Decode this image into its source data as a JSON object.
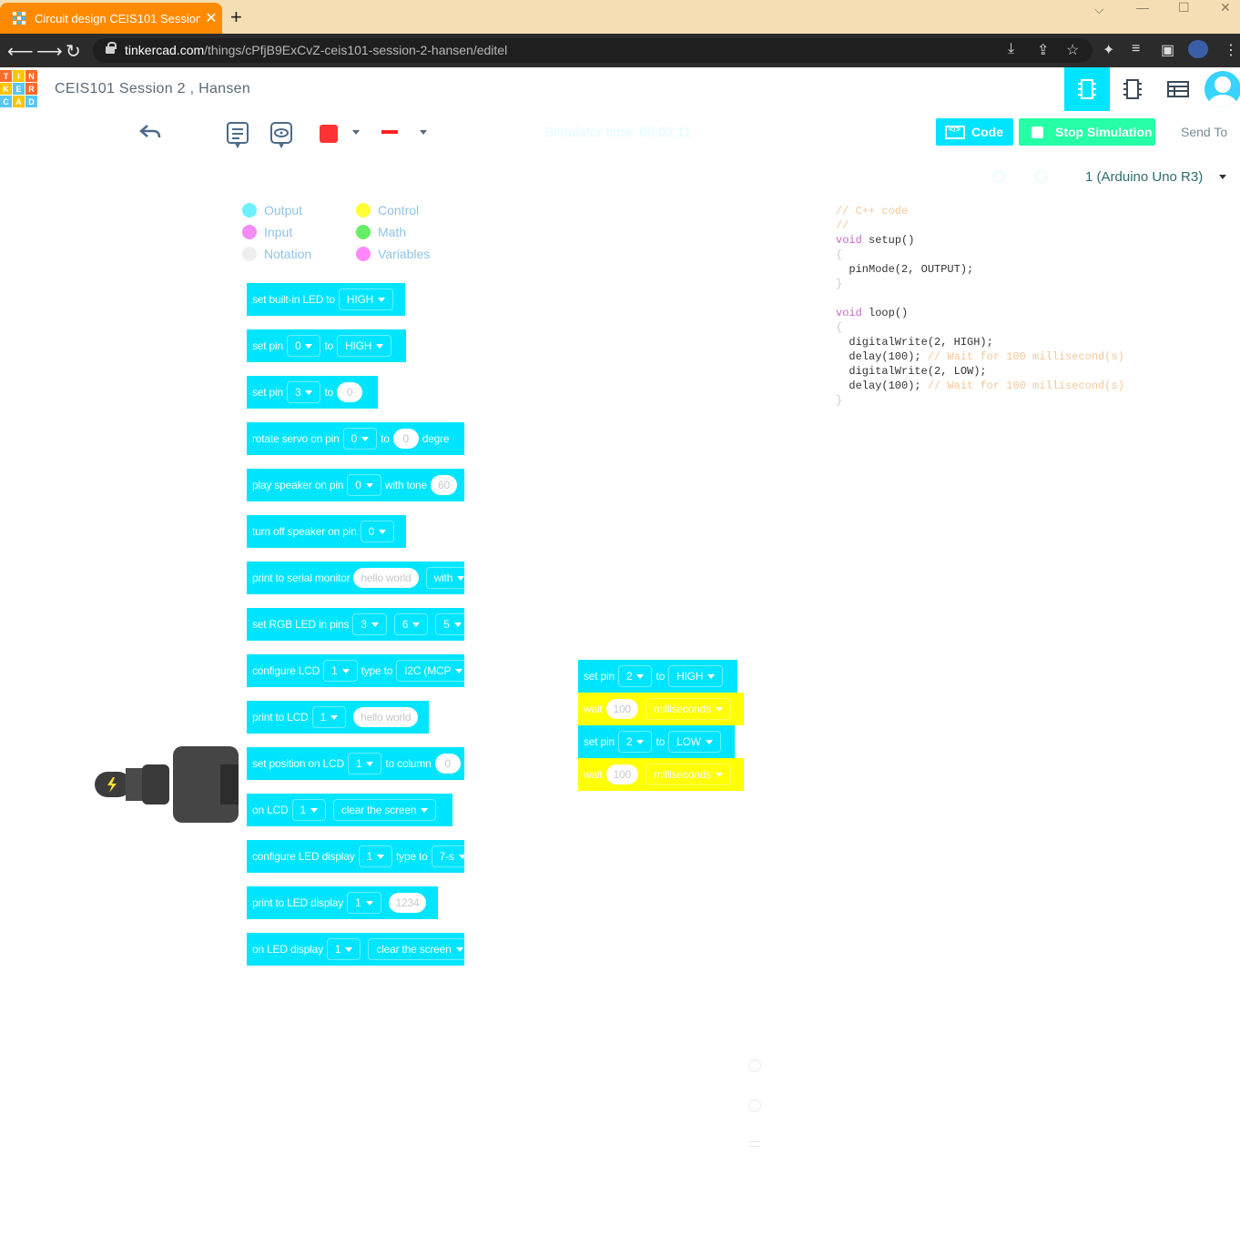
{
  "browser": {
    "tab_title": "Circuit design CEIS101 Session 2",
    "tab_close": "✕",
    "new_tab": "+",
    "url_host": "tinkercad.com",
    "url_path": "/things/cPfjB9ExCvZ-ceis101-session-2-hansen/editel",
    "window_controls": [
      "⌵",
      "—",
      "☐",
      "✕"
    ]
  },
  "app": {
    "logo_letters": [
      "T",
      "I",
      "N",
      "K",
      "E",
      "R",
      "C",
      "A",
      "D"
    ],
    "design_title": "CEIS101 Session 2 , Hansen"
  },
  "toolbar": {
    "simulator_time": "Simulator time: 00:02:11",
    "code_label": "Code",
    "stop_label": "Stop Simulation",
    "send_to_label": "Send To",
    "device_select": "1 (Arduino Uno R3)",
    "fill_color": "#ff3333",
    "line_color": "#ff2222"
  },
  "legend": {
    "items": [
      {
        "label": "Output",
        "color": "#6ff0ff"
      },
      {
        "label": "Input",
        "color": "#f28cf2"
      },
      {
        "label": "Notation",
        "color": "#eeeeee"
      },
      {
        "label": "Control",
        "color": "#ffff33"
      },
      {
        "label": "Math",
        "color": "#66ee66"
      },
      {
        "label": "Variables",
        "color": "#ff88ff"
      }
    ]
  },
  "palette": {
    "b1": {
      "text": "set built-in LED to",
      "dd": "HIGH"
    },
    "b2": {
      "text": "set pin",
      "dd1": "0",
      "to": "to",
      "dd2": "HIGH"
    },
    "b3": {
      "text": "set pin",
      "dd1": "3",
      "to": "to",
      "val": "0"
    },
    "b4": {
      "text": "rotate servo on pin",
      "dd1": "0",
      "to": "to",
      "val": "0",
      "tail": "degre"
    },
    "b5": {
      "text": "play speaker on pin",
      "dd1": "0",
      "mid": "with tone",
      "val": "60"
    },
    "b6": {
      "text": "turn off speaker on pin",
      "dd1": "0"
    },
    "b7": {
      "text": "print to serial monitor",
      "val": "hello world",
      "tail": "with"
    },
    "b8": {
      "text": "set RGB LED in pins",
      "dd1": "3",
      "dd2": "6",
      "dd3": "5"
    },
    "b9": {
      "text": "configure LCD",
      "dd1": "1",
      "mid": "type to",
      "dd2": "I2C (MCP"
    },
    "b10": {
      "text": "print to LCD",
      "dd1": "1",
      "val": "hello world"
    },
    "b11": {
      "text": "set position on LCD",
      "dd1": "1",
      "mid": "to column",
      "val": "0"
    },
    "b12": {
      "text": "on LCD",
      "dd1": "1",
      "dd2": "clear the screen"
    },
    "b13": {
      "text": "configure LED display",
      "dd1": "1",
      "mid": "type to",
      "dd2": "7-s"
    },
    "b14": {
      "text": "print to LED display",
      "dd1": "1",
      "val": "1234"
    },
    "b15": {
      "text": "on LED display",
      "dd1": "1",
      "dd2": "clear the screen"
    }
  },
  "program": {
    "s1": {
      "text": "set pin",
      "dd1": "2",
      "to": "to",
      "dd2": "HIGH"
    },
    "s2": {
      "text": "wait",
      "val": "100",
      "dd": "milliseconds"
    },
    "s3": {
      "text": "set pin",
      "dd1": "2",
      "to": "to",
      "dd2": "LOW"
    },
    "s4": {
      "text": "wait",
      "val": "100",
      "dd": "milliseconds"
    }
  },
  "code": {
    "l1": "// C++ code",
    "l2": "//",
    "l3a": "void",
    "l3b": " setup()",
    "l4": "{",
    "l5": "  pinMode(2, OUTPUT);",
    "l6": "}",
    "l7a": "void",
    "l7b": " loop()",
    "l8": "{",
    "l9": "  digitalWrite(2, HIGH);",
    "l10a": "  delay(100); ",
    "l10b": "// Wait for 100 millisecond(s)",
    "l11": "  digitalWrite(2, LOW);",
    "l12a": "  delay(100); ",
    "l12b": "// Wait for 100 millisecond(s)",
    "l13": "}"
  }
}
